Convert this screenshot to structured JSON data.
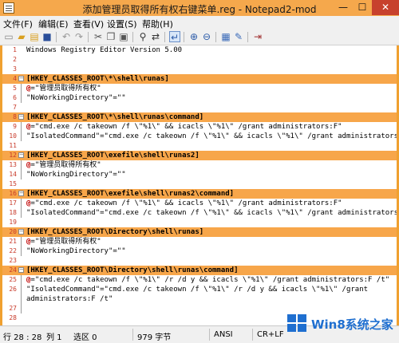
{
  "window": {
    "title": "添加管理员取得所有权右键菜单.reg - Notepad2-mod",
    "min_label": "—",
    "max_label": "☐",
    "close_label": "✕"
  },
  "menu": [
    "文件(F)",
    "编辑(E)",
    "查看(V)",
    "设置(S)",
    "帮助(H)"
  ],
  "toolbar_icons": [
    "new-icon",
    "open-icon",
    "browse-icon",
    "save-icon",
    "undo-icon",
    "redo-icon",
    "cut-icon",
    "copy-icon",
    "paste-icon",
    "find-icon",
    "replace-icon",
    "word-wrap-icon",
    "zoom-in-icon",
    "zoom-out-icon",
    "schemes-icon",
    "settings-icon",
    "exit-icon"
  ],
  "lines": [
    {
      "n": "1",
      "text": "Windows Registry Editor Version 5.00",
      "section": false
    },
    {
      "n": "2",
      "text": "",
      "section": false
    },
    {
      "n": "3",
      "text": "",
      "section": false
    },
    {
      "n": "4",
      "text": "[HKEY_CLASSES_ROOT\\*\\shell\\runas]",
      "section": true
    },
    {
      "n": "5",
      "at": "@",
      "text": "=\"管理员取得所有权\"",
      "section": false
    },
    {
      "n": "6",
      "text": "\"NoWorkingDirectory\"=\"\"",
      "section": false
    },
    {
      "n": "7",
      "text": "",
      "section": false
    },
    {
      "n": "8",
      "text": "[HKEY_CLASSES_ROOT\\*\\shell\\runas\\command]",
      "section": true
    },
    {
      "n": "9",
      "at": "@",
      "text": "=\"cmd.exe /c takeown /f \\\"%1\\\" && icacls \\\"%1\\\" /grant administrators:F\"",
      "section": false
    },
    {
      "n": "10",
      "text": "\"IsolatedCommand\"=\"cmd.exe /c takeown /f \\\"%1\\\" && icacls \\\"%1\\\" /grant administrators:F\"",
      "section": false
    },
    {
      "n": "11",
      "text": "",
      "section": false
    },
    {
      "n": "12",
      "text": "[HKEY_CLASSES_ROOT\\exefile\\shell\\runas2]",
      "section": true
    },
    {
      "n": "13",
      "at": "@",
      "text": "=\"管理员取得所有权\"",
      "section": false
    },
    {
      "n": "14",
      "text": "\"NoWorkingDirectory\"=\"\"",
      "section": false
    },
    {
      "n": "15",
      "text": "",
      "section": false
    },
    {
      "n": "16",
      "text": "[HKEY_CLASSES_ROOT\\exefile\\shell\\runas2\\command]",
      "section": true
    },
    {
      "n": "17",
      "at": "@",
      "text": "=\"cmd.exe /c takeown /f \\\"%1\\\" && icacls \\\"%1\\\" /grant administrators:F\"",
      "section": false
    },
    {
      "n": "18",
      "text": "\"IsolatedCommand\"=\"cmd.exe /c takeown /f \\\"%1\\\" && icacls \\\"%1\\\" /grant administrators:F\"",
      "section": false
    },
    {
      "n": "19",
      "text": "",
      "section": false
    },
    {
      "n": "20",
      "text": "[HKEY_CLASSES_ROOT\\Directory\\shell\\runas]",
      "section": true
    },
    {
      "n": "21",
      "at": "@",
      "text": "=\"管理员取得所有权\"",
      "section": false
    },
    {
      "n": "22",
      "text": "\"NoWorkingDirectory\"=\"\"",
      "section": false
    },
    {
      "n": "23",
      "text": "",
      "section": false
    },
    {
      "n": "24",
      "text": "[HKEY_CLASSES_ROOT\\Directory\\shell\\runas\\command]",
      "section": true
    },
    {
      "n": "25",
      "at": "@",
      "text": "=\"cmd.exe /c takeown /f \\\"%1\\\" /r /d y && icacls \\\"%1\\\" /grant administrators:F /t\"",
      "section": false
    },
    {
      "n": "26",
      "text": "\"IsolatedCommand\"=\"cmd.exe /c takeown /f \\\"%1\\\" /r /d y && icacls \\\"%1\\\" /grant",
      "section": false
    },
    {
      "n": "",
      "text": "administrators:F /t\"",
      "section": false
    },
    {
      "n": "27",
      "text": "",
      "section": false
    },
    {
      "n": "28",
      "text": "",
      "section": false
    }
  ],
  "status": {
    "position": "行 28 : 28",
    "column": "列 1",
    "selection": "选区 0",
    "size": "979 字节",
    "encoding": "ANSI",
    "eol": "CR+LF"
  },
  "watermark": {
    "text": "Win8系统之家"
  }
}
